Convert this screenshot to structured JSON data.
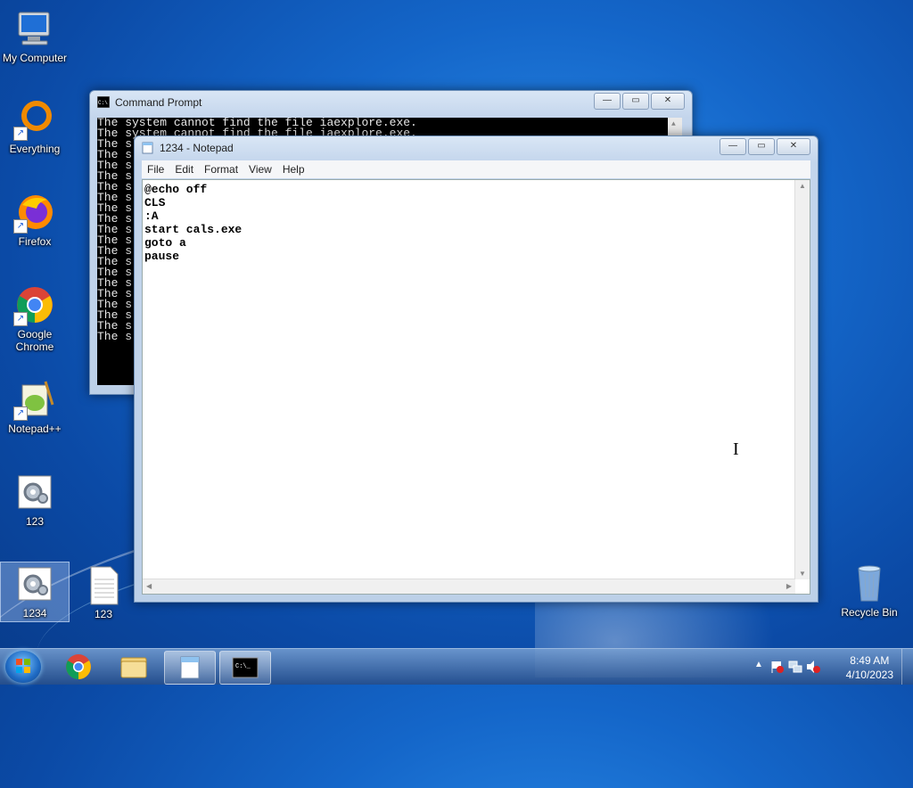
{
  "desktop": {
    "icons": [
      {
        "label": "My Computer"
      },
      {
        "label": "Everything"
      },
      {
        "label": "Firefox"
      },
      {
        "label": "Google Chrome"
      },
      {
        "label": "Notepad++"
      },
      {
        "label": "123"
      },
      {
        "label": "1234"
      },
      {
        "label": "123"
      },
      {
        "label": "Recycle Bin"
      }
    ]
  },
  "cmd_window": {
    "title": "Command Prompt",
    "lines": [
      "The system cannot find the file iaexplore.exe.",
      "The system cannot find the file iaexplore.exe.",
      "The s",
      "The s",
      "The s",
      "The s",
      "The s",
      "The s",
      "The s",
      "The s",
      "The s",
      "The s",
      "The s",
      "The s",
      "The s",
      "The s",
      "The s",
      "The s",
      "The s",
      "The s",
      "The s"
    ]
  },
  "notepad": {
    "title": "1234 - Notepad",
    "menu": [
      "File",
      "Edit",
      "Format",
      "View",
      "Help"
    ],
    "content": "@echo off\nCLS\n:A\nstart cals.exe\ngoto a\npause"
  },
  "taskbar": {
    "clock_time": "8:49 AM",
    "clock_date": "4/10/2023"
  },
  "icons": {
    "computer": "computer-icon",
    "everything": "everything-icon",
    "firefox": "firefox-icon",
    "chrome": "chrome-icon",
    "notepadpp": "notepad-plus-plus-icon",
    "batch": "gear-script-icon",
    "textfile": "text-file-icon",
    "recycle": "recycle-bin-icon"
  }
}
